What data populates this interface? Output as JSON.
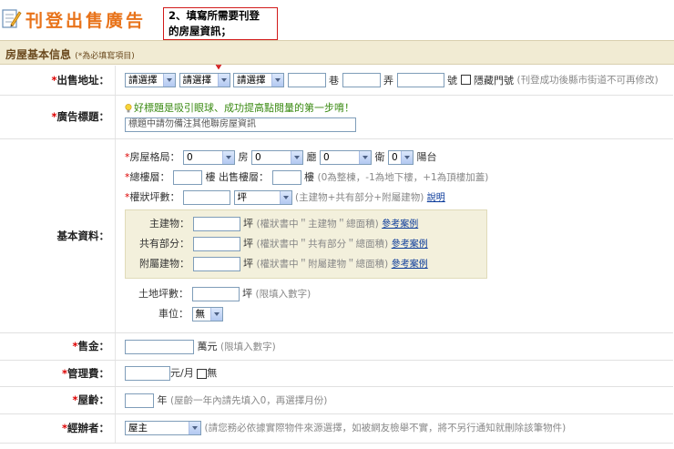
{
  "header": {
    "title": "刊登出售廣告",
    "callout_line1": "2、填寫所需要刊登",
    "callout_line2": "的房屋資訊；"
  },
  "section": {
    "title": "房屋基本信息",
    "note": "(*為必填寫項目)"
  },
  "address": {
    "label": "出售地址：",
    "select1": "請選擇",
    "select2": "請選擇",
    "select3": "請選擇",
    "lane": "巷",
    "alley": "弄",
    "number": "號",
    "hide_label": "隱藏門號",
    "note": "(刊登成功後縣市街道不可再修改)"
  },
  "ad_title": {
    "label": "廣告標題：",
    "tip": "好標題是吸引眼球、成功提高點閱量的第一步唷！",
    "placeholder": "標題中請勿備注其他聯房屋資訊"
  },
  "basic": {
    "label": "基本資料：",
    "layout_label": "房屋格局：",
    "room_value": "0",
    "room_unit": "房",
    "hall_value": "0",
    "hall_unit": "廳",
    "bath_value": "0",
    "bath_unit": "衛",
    "balcony_value": "0",
    "balcony_unit": "陽台",
    "floors_label": "總樓層：",
    "floors_unit": "樓",
    "sale_floor_label": "出售樓層：",
    "sale_floor_unit": "樓",
    "floor_note": "(0為整棟，-1為地下樓，+1為頂樓加蓋)",
    "area_label": "權狀坪數：",
    "area_unit_select": "坪",
    "area_note": "(主建物+共有部分+附屬建物)",
    "area_link": "說明",
    "main_label": "主建物：",
    "main_unit": "坪",
    "main_note": "(權狀書中＂主建物＂總面積)",
    "common_label": "共有部分：",
    "common_unit": "坪",
    "common_note": "(權狀書中＂共有部分＂總面積)",
    "attached_label": "附屬建物：",
    "attached_unit": "坪",
    "attached_note": "(權狀書中＂附屬建物＂總面積)",
    "example_link": "參考案例",
    "land_label": "土地坪數：",
    "land_unit": "坪",
    "land_note": "(限填入數字)",
    "parking_label": "車位：",
    "parking_value": "無"
  },
  "price": {
    "label": "售金：",
    "unit": "萬元",
    "note": "(限填入數字)"
  },
  "fee": {
    "label": "管理費：",
    "unit": "元/月",
    "none_label": "無"
  },
  "age": {
    "label": "屋齡：",
    "unit": "年",
    "note": "(屋齡一年內請先填入0，再選擇月份)"
  },
  "agent": {
    "label": "經辦者：",
    "value": "屋主",
    "note": "(請您務必依據實際物件來源選擇，如被網友檢舉不實，將不另行通知就刪除該筆物件)"
  },
  "colors": {
    "title_orange": "#e8731a",
    "callout_red": "#d21a1a",
    "required_red": "#dd0000",
    "section_bg": "#f1ebd3",
    "inner_box_bg": "#f3f0dc",
    "tip_green": "#3a8a12",
    "link_blue": "#0a3a9a"
  },
  "icons": [
    "edit-form-icon",
    "lightbulb-icon",
    "down-arrow-icon",
    "chevron-down-icon"
  ]
}
